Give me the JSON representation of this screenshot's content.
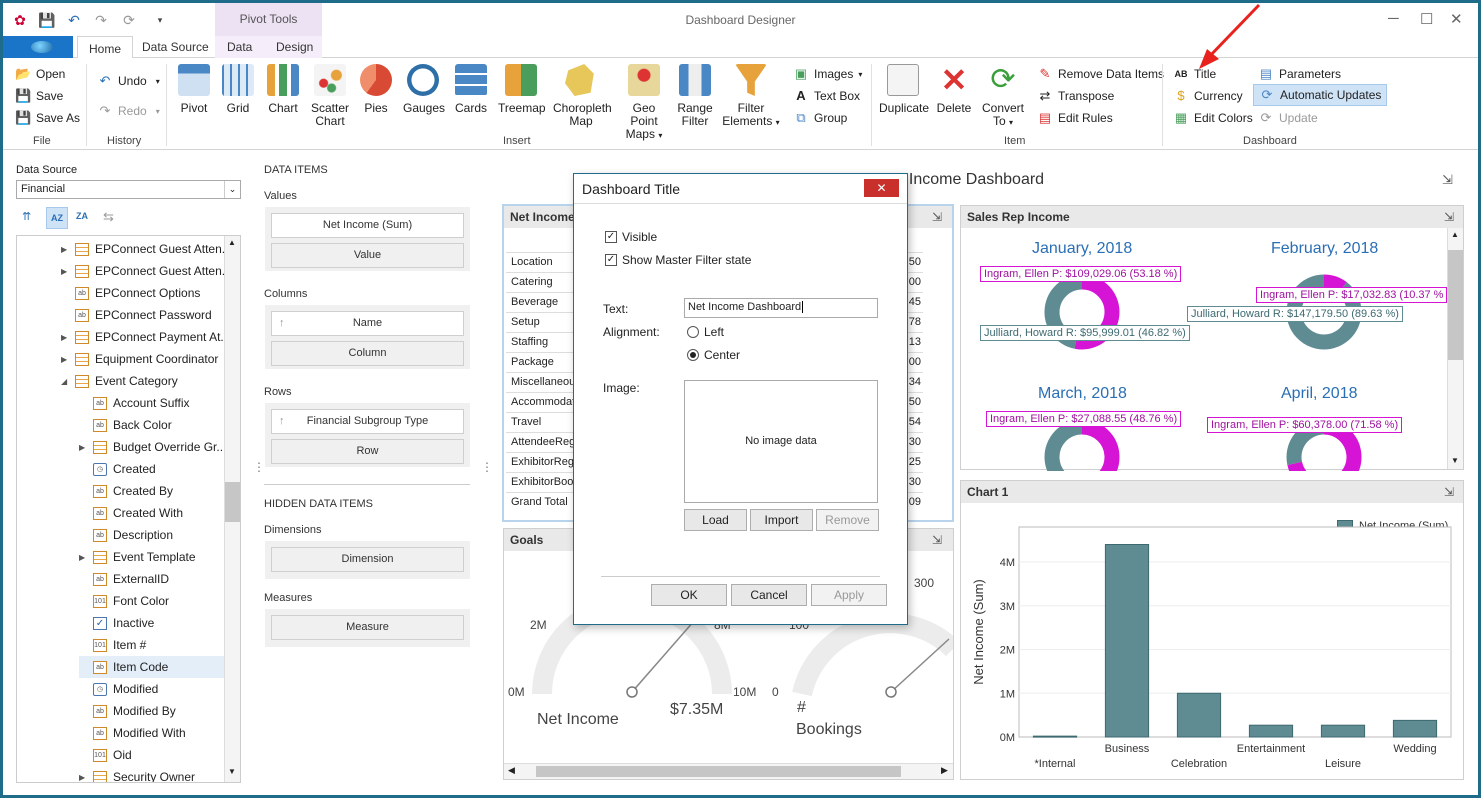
{
  "window": {
    "title": "Dashboard Designer",
    "contextual_header": "Pivot Tools"
  },
  "tabs": {
    "home": "Home",
    "data_source": "Data Source",
    "data": "Data",
    "design": "Design"
  },
  "ribbon": {
    "file": {
      "open": "Open",
      "save": "Save",
      "save_as": "Save As",
      "group": "File"
    },
    "history": {
      "undo": "Undo",
      "redo": "Redo",
      "group": "History"
    },
    "insert": {
      "pivot": "Pivot",
      "grid": "Grid",
      "chart": "Chart",
      "scatter_1": "Scatter",
      "scatter_2": "Chart",
      "pies": "Pies",
      "gauges": "Gauges",
      "cards": "Cards",
      "treemap": "Treemap",
      "choropleth_1": "Choropleth",
      "choropleth_2": "Map",
      "geo_1": "Geo Point",
      "geo_2": "Maps",
      "range_1": "Range",
      "range_2": "Filter",
      "filter_1": "Filter",
      "filter_2": "Elements",
      "images": "Images",
      "text_box": "Text Box",
      "group_btn": "Group",
      "group": "Insert"
    },
    "item": {
      "duplicate": "Duplicate",
      "delete": "Delete",
      "convert_1": "Convert",
      "convert_2": "To",
      "remove_data_items": "Remove Data Items",
      "transpose": "Transpose",
      "edit_rules": "Edit Rules",
      "group": "Item"
    },
    "dashboard": {
      "title": "Title",
      "currency": "Currency",
      "edit_colors": "Edit Colors",
      "parameters": "Parameters",
      "automatic_updates": "Automatic Updates",
      "update": "Update",
      "group": "Dashboard"
    }
  },
  "data_source": {
    "label": "Data Source",
    "value": "Financial"
  },
  "fields": [
    {
      "label": "EPConnect Guest Atten...",
      "type": "tbl",
      "exp": "▶",
      "indent": 0
    },
    {
      "label": "EPConnect Guest Atten...",
      "type": "tbl",
      "exp": "▶",
      "indent": 0
    },
    {
      "label": "EPConnect Options",
      "type": "ab",
      "exp": "",
      "indent": 0
    },
    {
      "label": "EPConnect Password",
      "type": "ab",
      "exp": "",
      "indent": 0
    },
    {
      "label": "EPConnect Payment At...",
      "type": "tbl",
      "exp": "▶",
      "indent": 0
    },
    {
      "label": "Equipment Coordinator",
      "type": "tbl",
      "exp": "▶",
      "indent": 0
    },
    {
      "label": "Event Category",
      "type": "tbl",
      "exp": "◢",
      "indent": 0
    },
    {
      "label": "Account Suffix",
      "type": "ab",
      "exp": "",
      "indent": 1
    },
    {
      "label": "Back Color",
      "type": "ab",
      "exp": "",
      "indent": 1
    },
    {
      "label": "Budget Override Gr...",
      "type": "tbl",
      "exp": "▶",
      "indent": 1
    },
    {
      "label": "Created",
      "type": "clk",
      "exp": "",
      "indent": 1
    },
    {
      "label": "Created By",
      "type": "ab",
      "exp": "",
      "indent": 1
    },
    {
      "label": "Created With",
      "type": "ab",
      "exp": "",
      "indent": 1
    },
    {
      "label": "Description",
      "type": "ab",
      "exp": "",
      "indent": 1
    },
    {
      "label": "Event Template",
      "type": "tbl",
      "exp": "▶",
      "indent": 1
    },
    {
      "label": "ExternalID",
      "type": "ab",
      "exp": "",
      "indent": 1
    },
    {
      "label": "Font Color",
      "type": "num",
      "exp": "",
      "indent": 1
    },
    {
      "label": "Inactive",
      "type": "chk",
      "exp": "",
      "indent": 1
    },
    {
      "label": "Item #",
      "type": "num",
      "exp": "",
      "indent": 1
    },
    {
      "label": "Item Code",
      "type": "ab",
      "exp": "",
      "indent": 1
    },
    {
      "label": "Modified",
      "type": "clk",
      "exp": "",
      "indent": 1
    },
    {
      "label": "Modified By",
      "type": "ab",
      "exp": "",
      "indent": 1
    },
    {
      "label": "Modified With",
      "type": "ab",
      "exp": "",
      "indent": 1
    },
    {
      "label": "Oid",
      "type": "num",
      "exp": "",
      "indent": 1
    },
    {
      "label": "Security Owner",
      "type": "tbl",
      "exp": "▶",
      "indent": 1
    }
  ],
  "data_items": {
    "header": "DATA ITEMS",
    "values_label": "Values",
    "values_item": "Net Income (Sum)",
    "values_ph": "Value",
    "columns_label": "Columns",
    "columns_item": "Name",
    "columns_ph": "Column",
    "rows_label": "Rows",
    "rows_item": "Financial Subgroup Type",
    "rows_ph": "Row",
    "hidden_header": "HIDDEN DATA ITEMS",
    "dimensions_label": "Dimensions",
    "dimensions_ph": "Dimension",
    "measures_label": "Measures",
    "measures_ph": "Measure"
  },
  "dashboard": {
    "title_partial": "t Income Dashboard"
  },
  "pivot": {
    "header": "Net Income",
    "rows": [
      "Location",
      "Catering",
      "Beverage",
      "Setup",
      "Staffing",
      "Package",
      "Miscellaneous",
      "Accommodati",
      "Travel",
      "AttendeeRegi",
      "ExhibitorRegi",
      "ExhibitorBoot",
      "Grand Total"
    ],
    "right_digits": [
      "50",
      "00",
      "45",
      "78",
      "13",
      "00",
      "34",
      "50",
      "54",
      "30",
      "25",
      "30",
      "09"
    ]
  },
  "goals": {
    "header": "Goals",
    "g1_min": "0M",
    "g1_mid": "2M",
    "g1_max": "10M",
    "g1_top": "8M",
    "g1_value": "$7.35M",
    "g1_label": "Net Income",
    "g2_min": "0",
    "g2_top_left": "100",
    "g2_top": "300",
    "g2_label_1": "#",
    "g2_label_2": "Bookings"
  },
  "sales_rep": {
    "header": "Sales Rep Income",
    "months": [
      "January, 2018",
      "February, 2018",
      "March, 2018",
      "April, 2018"
    ],
    "labels": [
      {
        "text": "Ingram, Ellen P: $109,029.06 (53.18 %)",
        "kind": "p"
      },
      {
        "text": "Julliard, Howard R: $95,999.01 (46.82 %)",
        "kind": "j"
      },
      {
        "text": "Ingram, Ellen P: $17,032.83 (10.37 %",
        "kind": "p"
      },
      {
        "text": "Julliard, Howard R: $147,179.50 (89.63 %)",
        "kind": "j"
      },
      {
        "text": "Ingram, Ellen P: $27,088.55 (48.76 %)",
        "kind": "p"
      },
      {
        "text": "Ingram, Ellen P: $60,378.00 (71.58 %)",
        "kind": "p"
      }
    ],
    "colors": {
      "ingram": "#d614d6",
      "julliard": "#5f8c93"
    }
  },
  "chart1": {
    "header": "Chart 1",
    "legend": "Net Income (Sum)",
    "color": "#5f8c93"
  },
  "chart_data": {
    "type": "bar",
    "title": "",
    "ylabel": "Net Income (Sum)",
    "xlabel": "",
    "categories": [
      "*Internal",
      "Business",
      "Celebration",
      "Entertainment",
      "Leisure",
      "Wedding"
    ],
    "values": [
      0.02,
      4.4,
      1.0,
      0.27,
      0.27,
      0.38
    ],
    "y_ticks": [
      "0M",
      "1M",
      "2M",
      "3M",
      "4M"
    ],
    "ylim": [
      0,
      4.8
    ],
    "series": [
      {
        "name": "Net Income (Sum)",
        "values": [
          0.02,
          4.4,
          1.0,
          0.27,
          0.27,
          0.38
        ]
      }
    ]
  },
  "dialog": {
    "title": "Dashboard Title",
    "close": "✕",
    "visible": "Visible",
    "show_master": "Show Master Filter state",
    "text_label": "Text:",
    "text_value": "Net Income Dashboard",
    "alignment_label": "Alignment:",
    "left": "Left",
    "center": "Center",
    "image_label": "Image:",
    "no_image": "No image data",
    "load": "Load",
    "import": "Import",
    "remove": "Remove",
    "ok": "OK",
    "cancel": "Cancel",
    "apply": "Apply"
  }
}
